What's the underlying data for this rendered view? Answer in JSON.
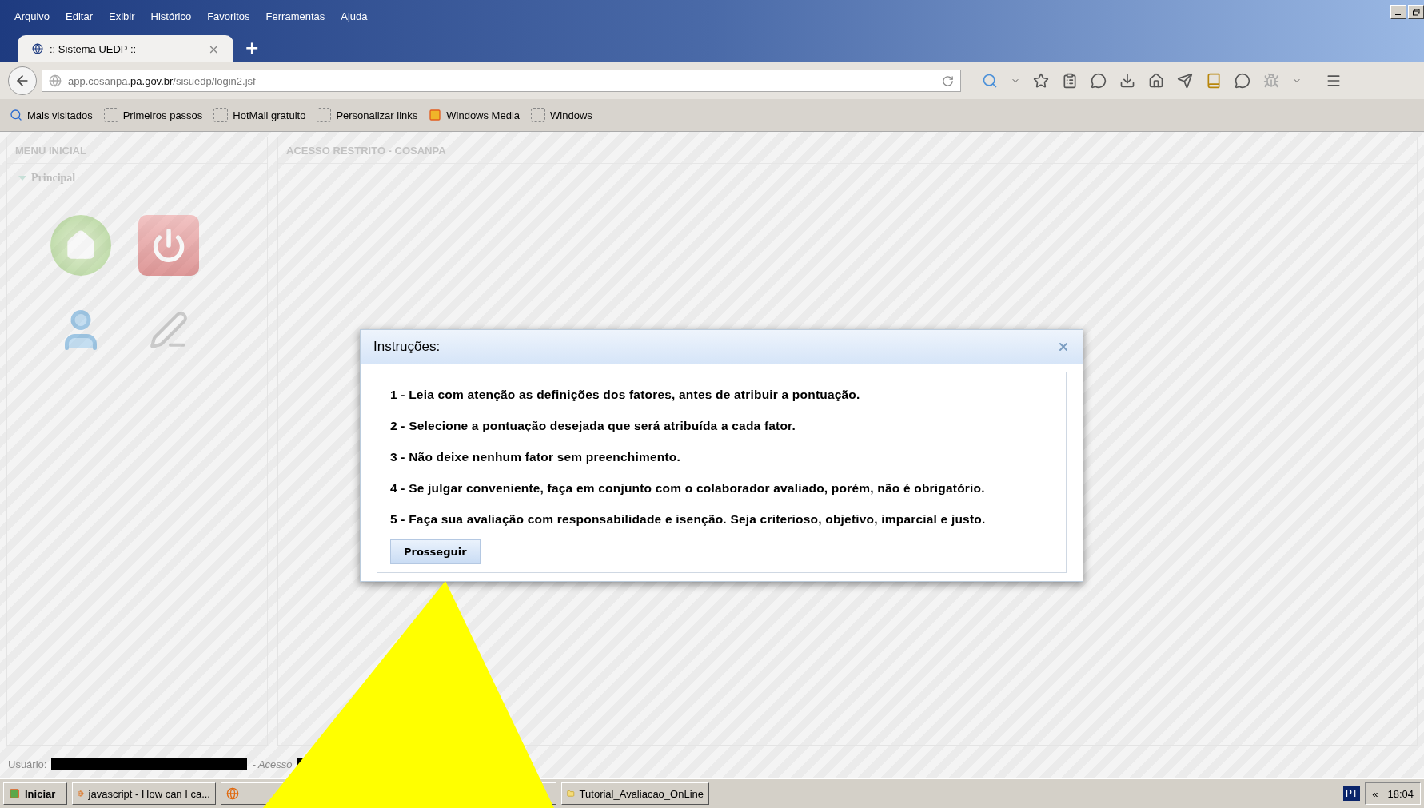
{
  "menu_bar": [
    "Arquivo",
    "Editar",
    "Exibir",
    "Histórico",
    "Favoritos",
    "Ferramentas",
    "Ajuda"
  ],
  "tab": {
    "title": ":: Sistema UEDP ::",
    "close": "×",
    "new_tab": "+",
    "selected": true
  },
  "address_bar": {
    "url": "app.cosanpa.**pa.gov.br**/sisuedp/login2.jsf"
  },
  "bookmarks": [
    {
      "label": "Mais visitados",
      "kind": "search"
    },
    {
      "label": "Primeiros passos",
      "kind": "page"
    },
    {
      "label": "HotMail gratuito",
      "kind": "page"
    },
    {
      "label": "Personalizar links",
      "kind": "page"
    },
    {
      "label": "Windows Media",
      "kind": "media"
    },
    {
      "label": "Windows",
      "kind": "page"
    }
  ],
  "sidebar": {
    "title": "MENU INICIAL",
    "section": "Principal",
    "expanded": true
  },
  "main": {
    "title": "ACESSO RESTRITO - COSANPA"
  },
  "dialog": {
    "title": "Instruções:",
    "items": [
      "1 - Leia com atenção as definições dos fatores, antes de atribuir a pontuação.",
      "2 - Selecione a pontuação desejada que será atribuída a cada fator.",
      "3 - Não deixe nenhum fator sem preenchimento.",
      "4 - Se julgar conveniente, faça em conjunto com o colaborador avaliado, porém, não é obrigatório.",
      "5 - Faça sua avaliação com responsabilidade e isenção. Seja criterioso, objetivo, imparcial e justo."
    ],
    "button": "Prosseguir"
  },
  "status": {
    "user_label": "Usuário:",
    "access_label": "- Acesso"
  },
  "taskbar": {
    "start": "Iniciar",
    "items": [
      {
        "kind": "browser",
        "label": "javascript - How can I ca..."
      },
      {
        "kind": "browser"
      },
      {
        "kind": "folder",
        "label": "Tutorial_Avaliacao_OnLine"
      }
    ],
    "language": "PT",
    "expand": "«",
    "clock": "18:04"
  }
}
